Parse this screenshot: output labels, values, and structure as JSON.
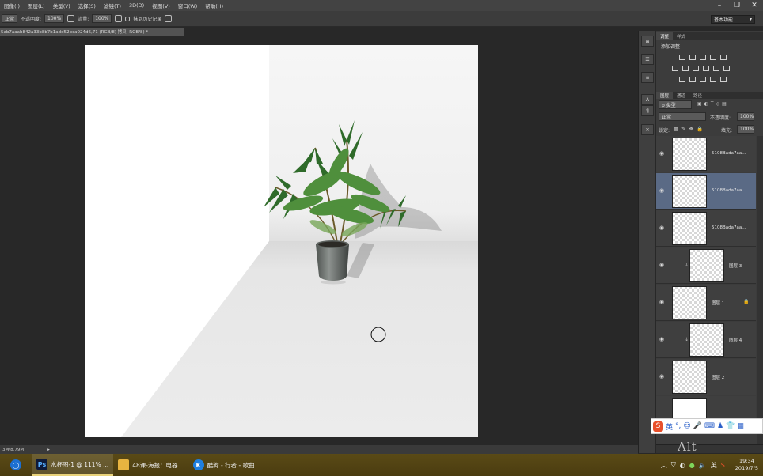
{
  "menu": [
    "图像(I)",
    "图层(L)",
    "类型(Y)",
    "选择(S)",
    "滤镜(T)",
    "3D(D)",
    "视图(V)",
    "窗口(W)",
    "帮助(H)"
  ],
  "window_controls": [
    "–",
    "❐",
    "✕"
  ],
  "options_bar": {
    "mode_value": "正常",
    "opacity_label": "不透明度:",
    "opacity_value": "100%",
    "flow_label": "流量:",
    "flow_value": "100%",
    "history_label": "抹到历史记录"
  },
  "workspace": "基本功能",
  "document_tab": "5ab7aaab842a33b8b7b1add52bca024d6,71 (RGB/8) 拷贝, RGB/8) *",
  "status": {
    "size": "3M/8.79M"
  },
  "adjustments_panel": {
    "tabs": [
      "调整",
      "样式"
    ],
    "title": "添加调整"
  },
  "layers_panel": {
    "tabs": [
      "图层",
      "通道",
      "路径"
    ],
    "filter_label": "ρ 类型",
    "blend_mode": "正常",
    "opacity_label": "不透明度:",
    "opacity_value": "100%",
    "lock_label": "锁定:",
    "fill_label": "填充:",
    "fill_value": "100%",
    "layers": [
      {
        "name": "5108Bada7aa..."
      },
      {
        "name": "5108Bada7aa..."
      },
      {
        "name": "5108Bada7aa..."
      },
      {
        "name": "图层 3"
      },
      {
        "name": "图层 1"
      },
      {
        "name": "图层 4"
      },
      {
        "name": "图层 2"
      }
    ]
  },
  "ime": {
    "lang": "英"
  },
  "key_hint": "Alt",
  "taskbar": {
    "tasks": [
      {
        "label": "水杯图-1 @ 111% ...",
        "icon": "Ps",
        "color": "#0e1a3a"
      },
      {
        "label": "48课-海报：电器...",
        "icon": "▮",
        "color": "#e8b440"
      },
      {
        "label": "酷狗 - 行者 - 歌曲...",
        "icon": "K",
        "color": "#1f7fe0"
      }
    ],
    "time": "19:34",
    "date": "2019/7/5"
  }
}
